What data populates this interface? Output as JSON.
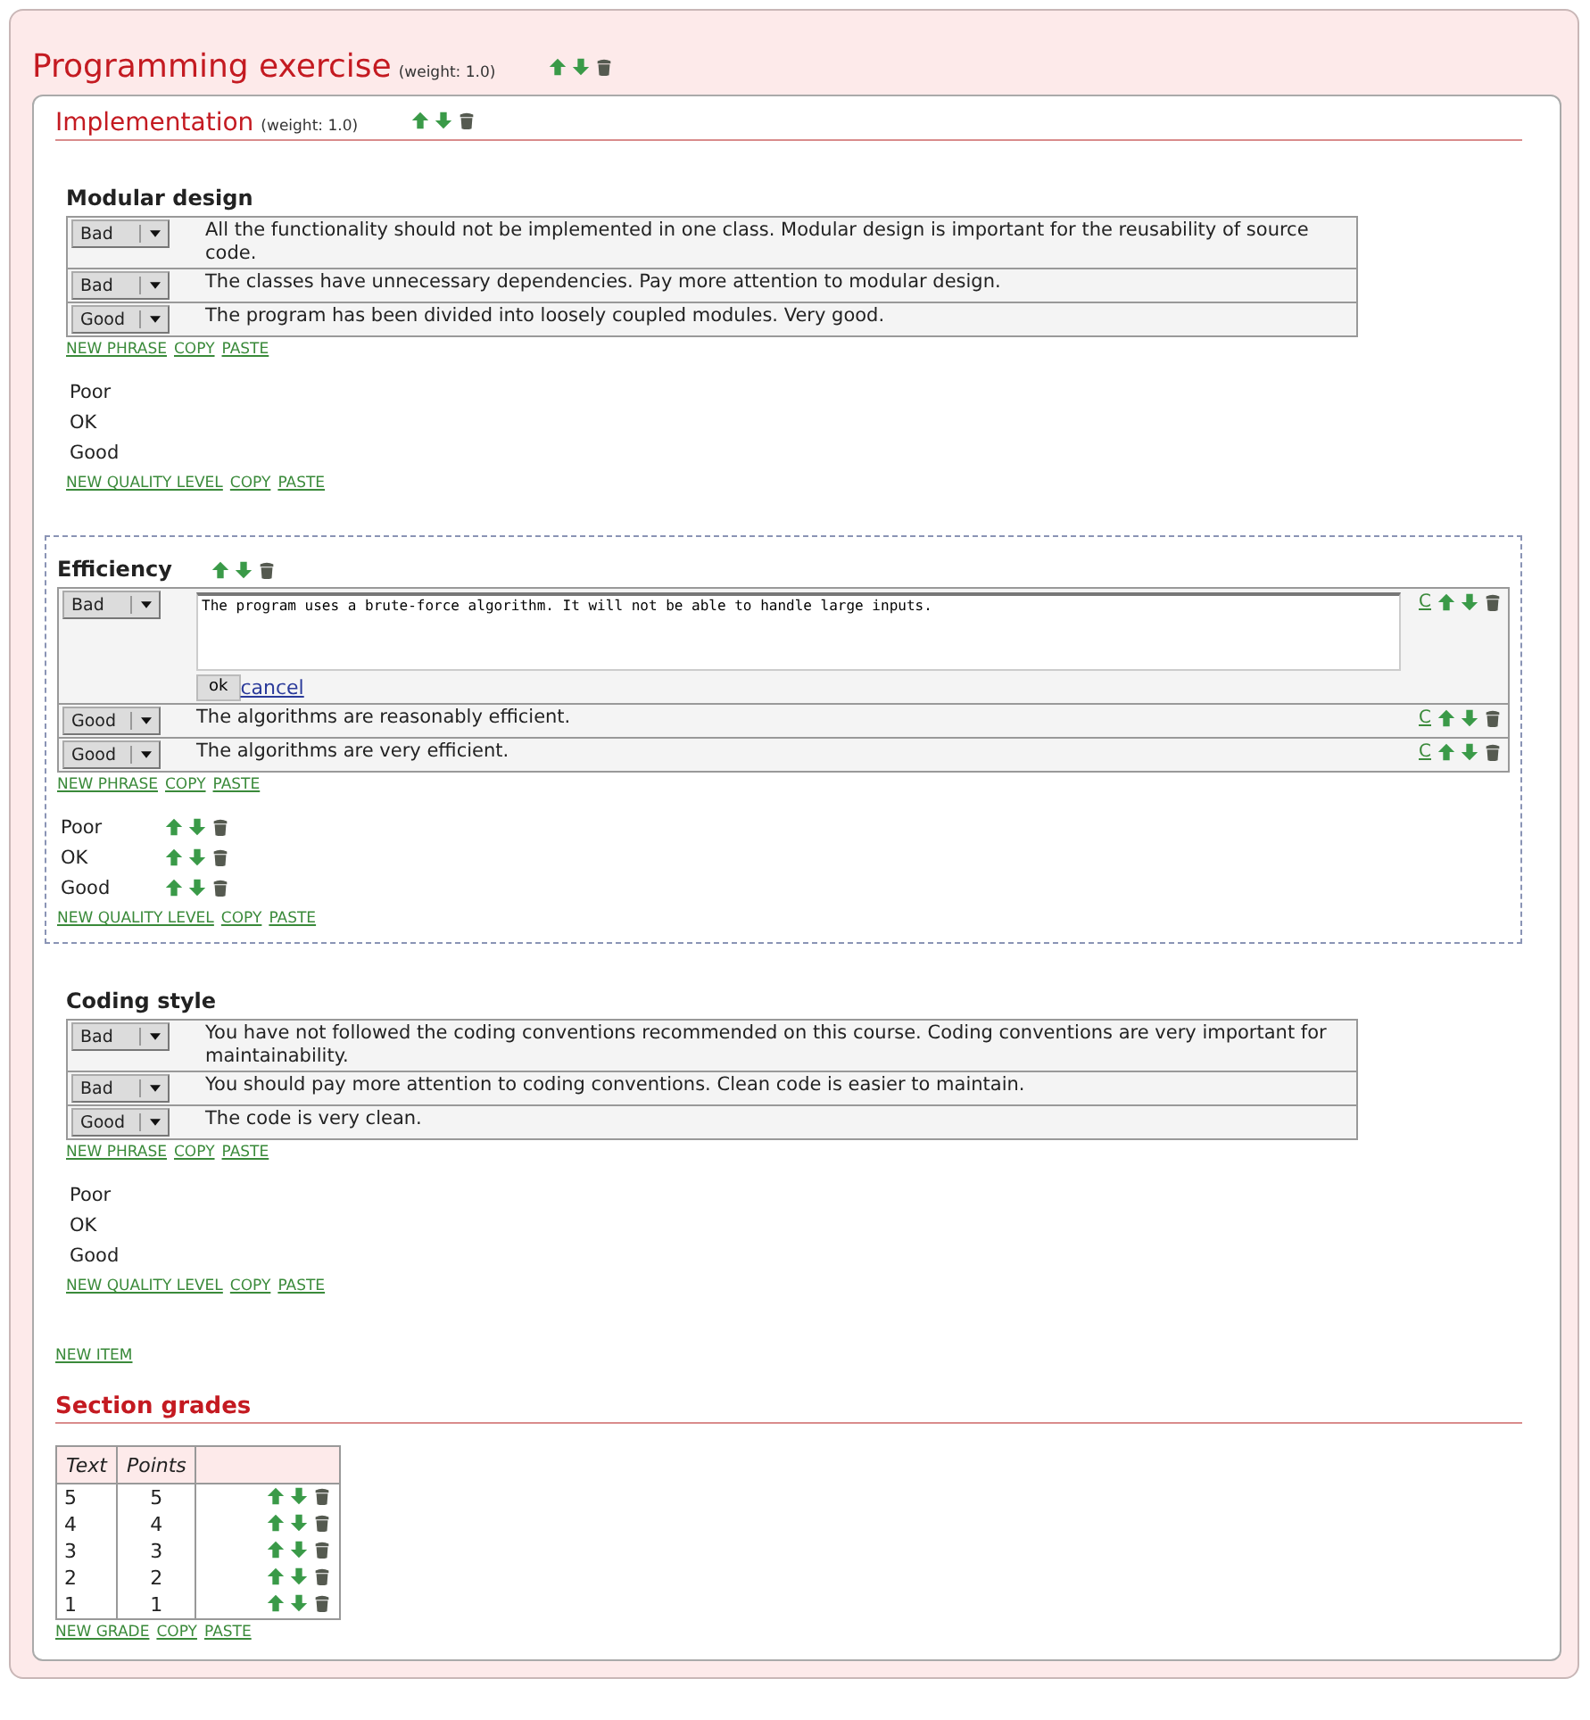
{
  "exercise": {
    "title": "Programming exercise",
    "weight": "(weight: 1.0)"
  },
  "section": {
    "title": "Implementation",
    "weight": "(weight: 1.0)",
    "items": [
      {
        "title": "Modular design",
        "active": false,
        "phrases": [
          {
            "kind": "view",
            "grade": "Bad",
            "text": "All the functionality should not be implemented in one class. Modular design is important for the reusability of source code."
          },
          {
            "kind": "view",
            "grade": "Bad",
            "text": "The classes have unnecessary dependencies. Pay more attention to modular design."
          },
          {
            "kind": "view",
            "grade": "Good",
            "text": "The program has been divided into loosely coupled modules. Very good."
          }
        ],
        "phrase_links": [
          "NEW PHRASE",
          "COPY",
          "PASTE"
        ],
        "levels": [
          "Poor",
          "OK",
          "Good"
        ],
        "level_links": [
          "NEW QUALITY LEVEL",
          "COPY",
          "PASTE"
        ]
      },
      {
        "title": "Efficiency",
        "active": true,
        "phrases": [
          {
            "kind": "edit",
            "grade": "Bad",
            "text": "The program uses a brute-force algorithm. It will not be able to handle large inputs.",
            "ok": "ok",
            "cancel": "cancel",
            "copy_link": "C"
          },
          {
            "kind": "view",
            "grade": "Good",
            "text": "The algorithms are reasonably efficient.",
            "copy_link": "C"
          },
          {
            "kind": "view",
            "grade": "Good",
            "text": "The algorithms are very efficient.",
            "copy_link": "C"
          }
        ],
        "phrase_links": [
          "NEW PHRASE",
          "COPY",
          "PASTE"
        ],
        "levels": [
          "Poor",
          "OK",
          "Good"
        ],
        "level_links": [
          "NEW QUALITY LEVEL",
          "COPY",
          "PASTE"
        ]
      },
      {
        "title": "Coding style",
        "active": false,
        "phrases": [
          {
            "kind": "view",
            "grade": "Bad",
            "text": "You have not followed the coding conventions recommended on this course. Coding conventions are very important for maintainability."
          },
          {
            "kind": "view",
            "grade": "Bad",
            "text": "You should pay more attention to coding conventions. Clean code is easier to maintain."
          },
          {
            "kind": "view",
            "grade": "Good",
            "text": "The code is very clean."
          }
        ],
        "phrase_links": [
          "NEW PHRASE",
          "COPY",
          "PASTE"
        ],
        "levels": [
          "Poor",
          "OK",
          "Good"
        ],
        "level_links": [
          "NEW QUALITY LEVEL",
          "COPY",
          "PASTE"
        ]
      }
    ],
    "new_item": "NEW ITEM",
    "grades": {
      "title": "Section grades",
      "columns": [
        "Text",
        "Points"
      ],
      "rows": [
        {
          "text": "5",
          "points": "5"
        },
        {
          "text": "4",
          "points": "4"
        },
        {
          "text": "3",
          "points": "3"
        },
        {
          "text": "2",
          "points": "2"
        },
        {
          "text": "1",
          "points": "1"
        }
      ],
      "links": [
        "NEW GRADE",
        "COPY",
        "PASTE"
      ]
    }
  }
}
